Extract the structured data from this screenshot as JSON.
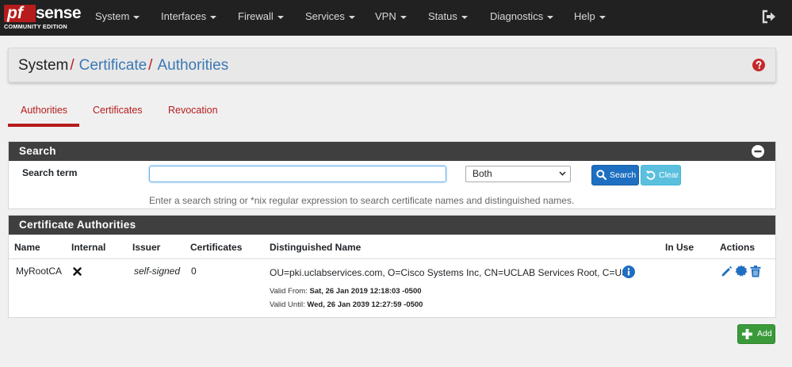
{
  "brand": {
    "logo_pf": "pf",
    "logo_sense": "sense",
    "edition": "COMMUNITY EDITION"
  },
  "nav": {
    "items": [
      "System",
      "Interfaces",
      "Firewall",
      "Services",
      "VPN",
      "Status",
      "Diagnostics",
      "Help"
    ]
  },
  "breadcrumb": {
    "parts": [
      "System",
      "Certificate",
      "Authorities"
    ],
    "separator": "/"
  },
  "tabs": [
    "Authorities",
    "Certificates",
    "Revocation"
  ],
  "active_tab": "Authorities",
  "search": {
    "title": "Search",
    "label": "Search term",
    "input_value": "",
    "select_value": "Both",
    "search_button": "Search",
    "clear_button": "Clear",
    "help": "Enter a search string or *nix regular expression to search certificate names and distinguished names."
  },
  "table": {
    "title": "Certificate Authorities",
    "columns": [
      "Name",
      "Internal",
      "Issuer",
      "Certificates",
      "Distinguished Name",
      "In Use",
      "Actions"
    ],
    "rows": [
      {
        "name": "MyRootCA",
        "internal": "no",
        "issuer": "self-signed",
        "certificates": "0",
        "dn": "OU=pki.uclabservices.com, O=Cisco Systems Inc, CN=UCLAB Services Root, C=US",
        "valid_from_label": "Valid From:",
        "valid_from": "Sat, 26 Jan 2019 12:18:03 -0500",
        "valid_until_label": "Valid Until:",
        "valid_until": "Wed, 26 Jan 2039 12:27:59 -0500",
        "in_use": ""
      }
    ]
  },
  "add_button": "Add",
  "colors": {
    "navbar": "#212121",
    "accent_red": "#b71c1c",
    "link_blue": "#3c78b4",
    "panel_header": "#3f3f3f",
    "btn_primary": "#1e6fc1",
    "btn_info": "#5bc0de",
    "btn_success": "#3a9a3a"
  }
}
